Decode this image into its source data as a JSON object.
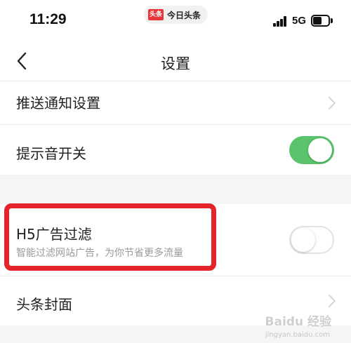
{
  "status_bar": {
    "time": "11:29",
    "app_name": "今日头条",
    "app_logo": "头条",
    "network": "5G",
    "battery_level": 0.55
  },
  "nav": {
    "back_icon": "chevron-left-icon",
    "title": "设置"
  },
  "settings": {
    "push": {
      "label": "推送通知设置"
    },
    "sound": {
      "label": "提示音开关",
      "enabled": true
    },
    "h5_filter": {
      "label": "H5广告过滤",
      "sublabel": "智能过滤网站广告，为你节省更多流量",
      "enabled": false
    },
    "cover": {
      "label": "头条封面"
    }
  },
  "colors": {
    "toggle_on": "#5ac36b",
    "highlight": "#e4232b",
    "section_gap": "#f4f5f6"
  },
  "watermark": {
    "text": "Baidu 经验",
    "sub": "jingyan.baidu.com"
  }
}
